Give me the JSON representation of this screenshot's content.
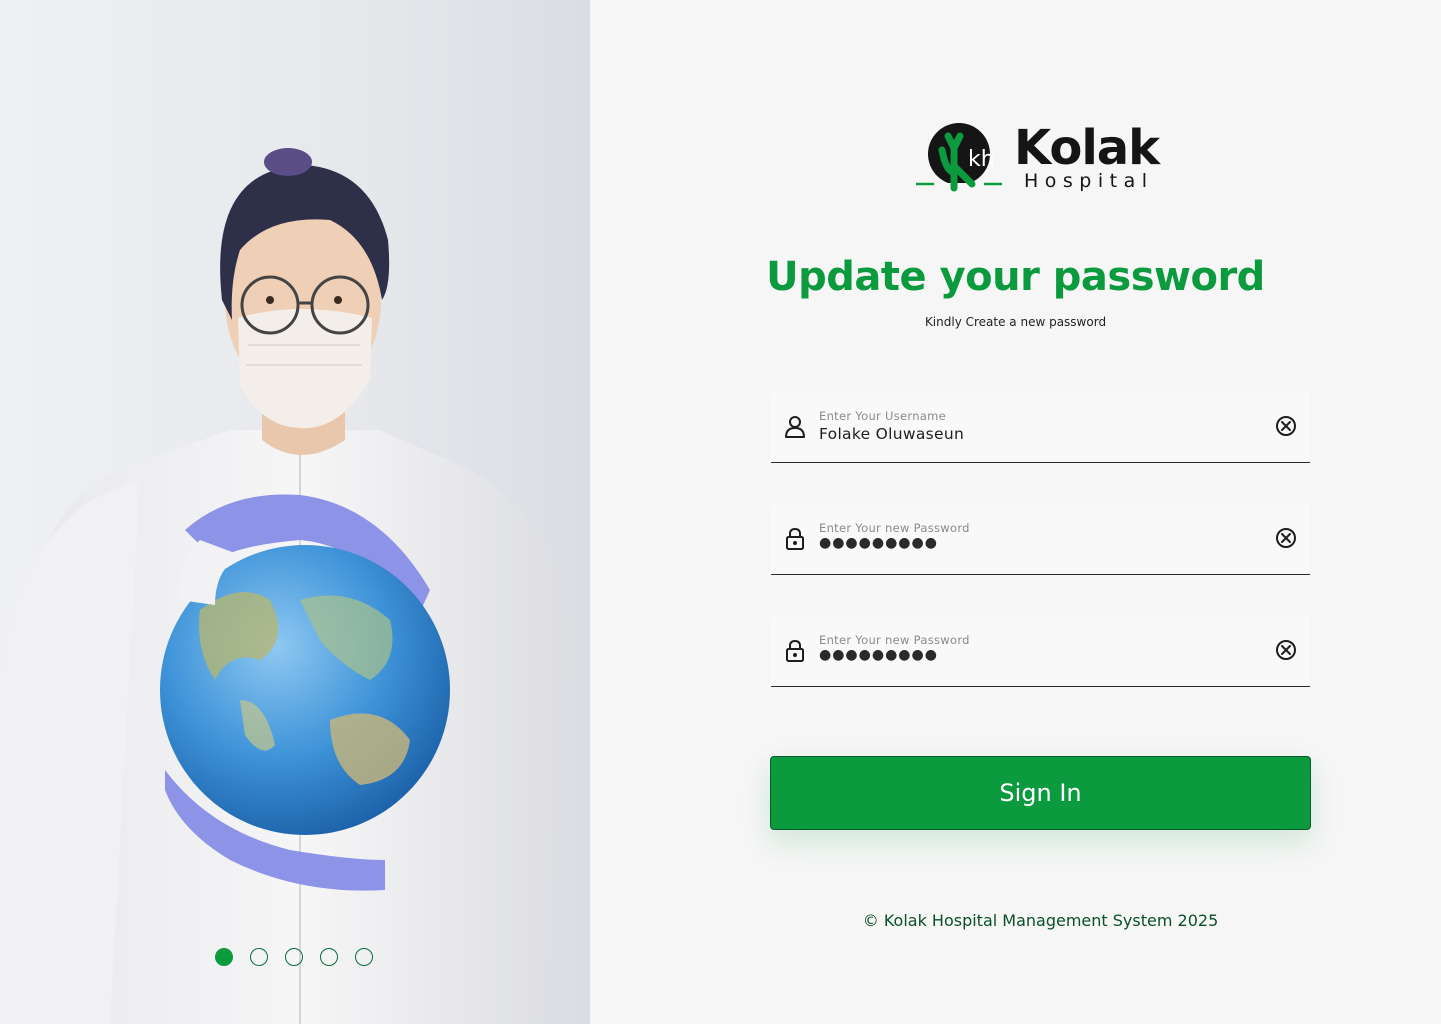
{
  "brand": {
    "name": "Kolak",
    "sub": "Hospital",
    "mark_letters": "kh"
  },
  "heading": {
    "title": "Update your password",
    "subtitle": "Kindly Create a new password"
  },
  "fields": [
    {
      "label": "Enter Your Username",
      "value": "Folake Oluwaseun",
      "icon": "user-icon"
    },
    {
      "label": "Enter Your new Password",
      "value": "●●●●●●●●●",
      "icon": "lock-icon"
    },
    {
      "label": "Enter Your new Password",
      "value": "●●●●●●●●●",
      "icon": "lock-icon"
    }
  ],
  "signin_label": "Sign In",
  "footer": "© Kolak Hospital Management System 2025",
  "carousel": {
    "count": 5,
    "active_index": 0
  },
  "colors": {
    "accent": "#0c9a3e",
    "dark": "#151515",
    "background": "#f6f6f6"
  }
}
